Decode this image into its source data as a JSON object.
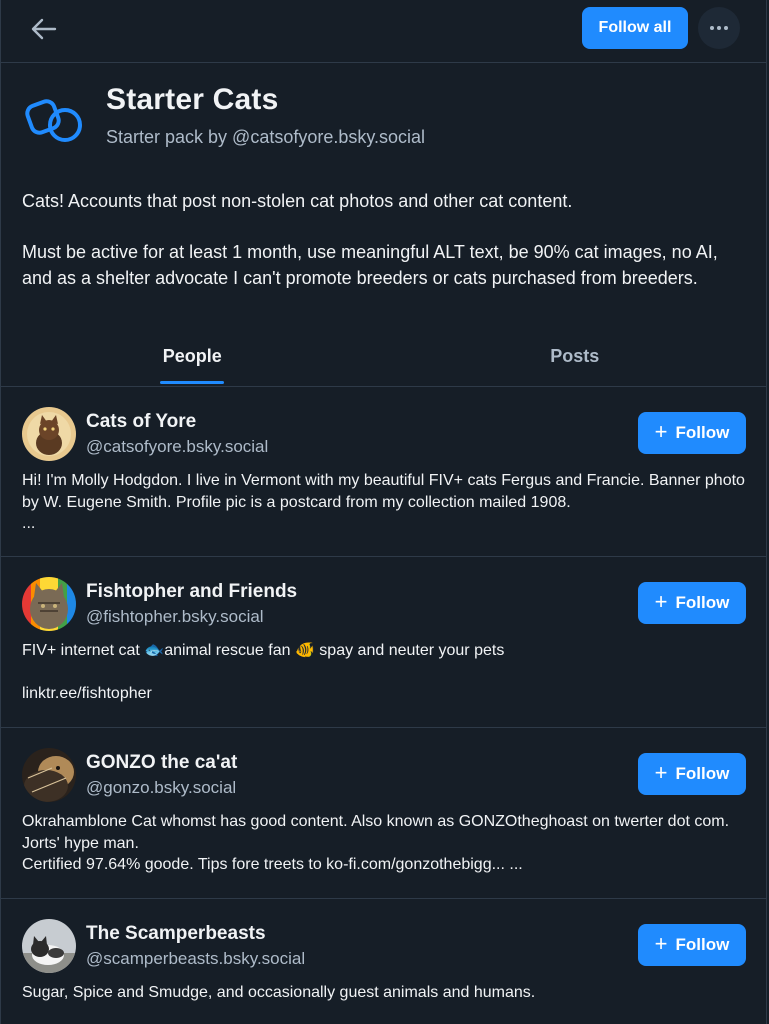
{
  "header": {
    "back_icon": "arrow-left-icon",
    "follow_all_label": "Follow all",
    "more_icon": "ellipsis-icon"
  },
  "pack": {
    "icon": "starter-pack-icon",
    "title": "Starter Cats",
    "subtitle": "Starter pack by @catsofyore.bsky.social",
    "description": [
      "Cats! Accounts that post non-stolen cat photos and other cat content.",
      "Must be active for at least 1 month, use meaningful ALT text, be 90% cat images, no AI, and as a shelter advocate I can't promote breeders or cats purchased from breeders."
    ]
  },
  "tabs": [
    {
      "label": "People",
      "active": true
    },
    {
      "label": "Posts",
      "active": false
    }
  ],
  "people": [
    {
      "name": "Cats of Yore",
      "handle": "@catsofyore.bsky.social",
      "follow_label": "Follow",
      "bio": "Hi! I'm Molly Hodgdon. I live in Vermont with my beautiful FIV+ cats Fergus and Francie. Banner photo by W. Eugene Smith. Profile pic is a postcard from my collection mailed 1908.\n..."
    },
    {
      "name": "Fishtopher and Friends",
      "handle": "@fishtopher.bsky.social",
      "follow_label": "Follow",
      "bio": "FIV+ internet cat 🐟animal rescue fan 🐠 spay and neuter your pets\n\nlinktr.ee/fishtopher"
    },
    {
      "name": "GONZO the ca'at",
      "handle": "@gonzo.bsky.social",
      "follow_label": "Follow",
      "bio": "Okrahamblone Cat whomst has good content. Also known as GONZOtheghoast  on twerter dot com. Jorts' hype man.\nCertified 97.64% goode. Tips fore  treets to ko-fi.com/gonzothebigg... ..."
    },
    {
      "name": "The Scamperbeasts",
      "handle": "@scamperbeasts.bsky.social",
      "follow_label": "Follow",
      "bio": "Sugar, Spice and Smudge, and occasionally guest animals and humans."
    }
  ],
  "colors": {
    "background": "#161e27",
    "border": "#2e3a48",
    "accent": "#208bfe",
    "text_primary": "#f1f3f5",
    "text_secondary": "#aebbc9"
  }
}
